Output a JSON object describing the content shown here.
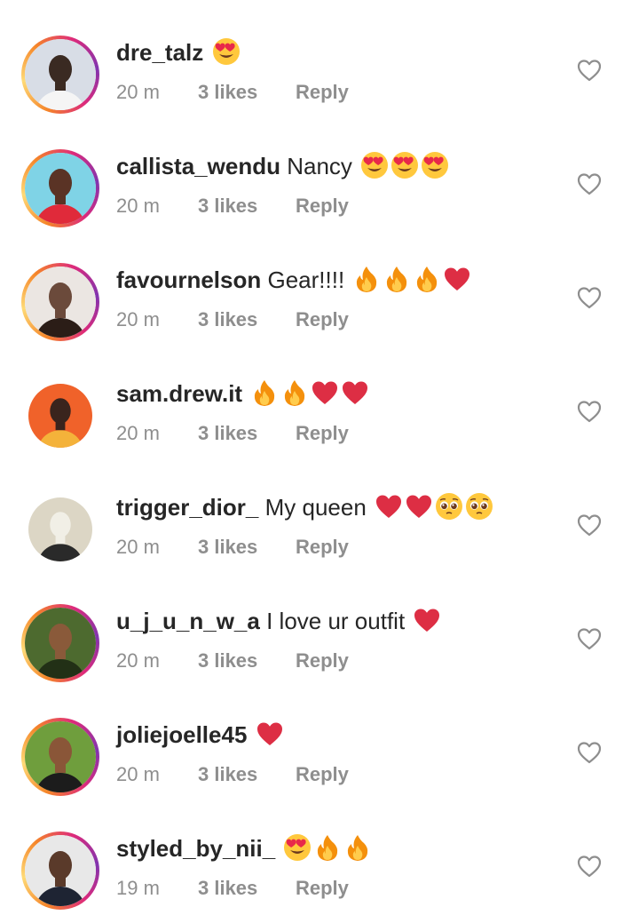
{
  "comments": [
    {
      "username": "dre_talz",
      "text": "",
      "emojis": [
        "heart-eyes"
      ],
      "time": "20 m",
      "likes": "3 likes",
      "reply": "Reply",
      "story_ring": true,
      "avatar_colors": [
        "#d8dde6",
        "#f5f5f5",
        "#3a2a22"
      ]
    },
    {
      "username": "callista_wendu",
      "text": "Nancy",
      "emojis": [
        "heart-eyes",
        "heart-eyes",
        "heart-eyes"
      ],
      "time": "20 m",
      "likes": "3 likes",
      "reply": "Reply",
      "story_ring": true,
      "avatar_colors": [
        "#7fd3e6",
        "#e02a3a",
        "#5a3325"
      ]
    },
    {
      "username": "favournelson",
      "text": "Gear!!!!",
      "emojis": [
        "fire",
        "fire",
        "fire",
        "red-heart"
      ],
      "time": "20 m",
      "likes": "3 likes",
      "reply": "Reply",
      "story_ring": true,
      "avatar_colors": [
        "#ebe6e2",
        "#2b1d17",
        "#6b4a3b"
      ]
    },
    {
      "username": "sam.drew.it",
      "text": "",
      "emojis": [
        "fire",
        "fire",
        "red-heart",
        "red-heart"
      ],
      "time": "20 m",
      "likes": "3 likes",
      "reply": "Reply",
      "story_ring": false,
      "avatar_colors": [
        "#f0622a",
        "#f4b23a",
        "#3a241d"
      ]
    },
    {
      "username": "trigger_dior_",
      "text": "My queen",
      "emojis": [
        "red-heart",
        "red-heart",
        "pleading-face",
        "pleading-face"
      ],
      "time": "20 m",
      "likes": "3 likes",
      "reply": "Reply",
      "story_ring": false,
      "avatar_colors": [
        "#dcd6c5",
        "#2a2a2a",
        "#f1efe6"
      ]
    },
    {
      "username": "u_j_u_n_w_a",
      "text": "I love ur outfit",
      "emojis": [
        "red-heart"
      ],
      "time": "20 m",
      "likes": "3 likes",
      "reply": "Reply",
      "story_ring": true,
      "avatar_colors": [
        "#4d6a2f",
        "#223016",
        "#8a5a3a"
      ]
    },
    {
      "username": "joliejoelle45",
      "text": "",
      "emojis": [
        "red-heart"
      ],
      "time": "20 m",
      "likes": "3 likes",
      "reply": "Reply",
      "story_ring": true,
      "avatar_colors": [
        "#6f9e3d",
        "#1c1c1c",
        "#8a5638"
      ]
    },
    {
      "username": "styled_by_nii_",
      "text": "",
      "emojis": [
        "heart-eyes",
        "fire",
        "fire"
      ],
      "time": "19 m",
      "likes": "3 likes",
      "reply": "Reply",
      "story_ring": true,
      "avatar_colors": [
        "#e8e8e8",
        "#1e2433",
        "#5a3a2a"
      ]
    }
  ],
  "colors": {
    "text_primary": "#262626",
    "text_secondary": "#8e8e8e",
    "like_outline": "#8e8e8e",
    "background": "#ffffff"
  }
}
